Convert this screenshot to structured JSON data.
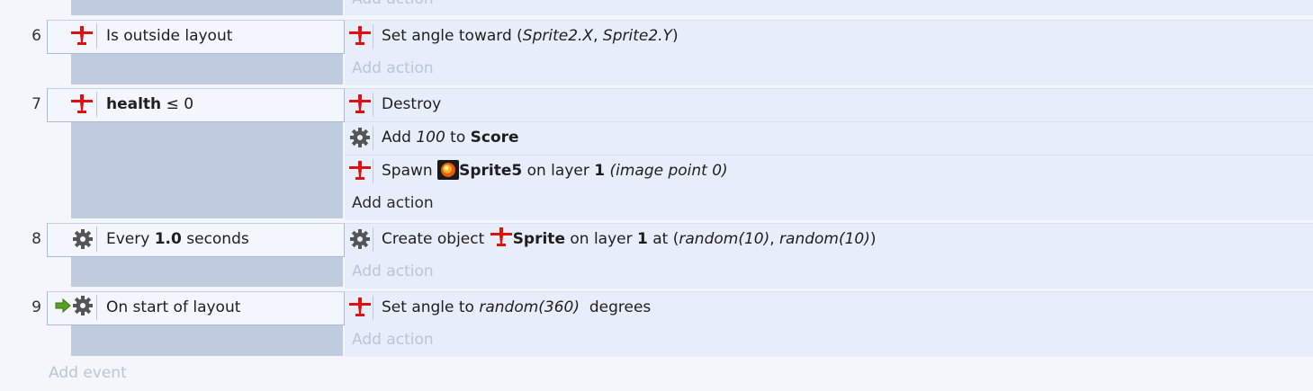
{
  "top_partial": {
    "add_action": "Add action"
  },
  "events": [
    {
      "number": "6",
      "condition": {
        "icon": "plane-icon",
        "text": "Is outside layout"
      },
      "actions": [
        {
          "icon": "plane-icon",
          "prefix": "Set angle toward (",
          "arg1": "Sprite2.X",
          "sep": ", ",
          "arg2": "Sprite2.Y",
          "suffix": ")"
        }
      ],
      "add_action": "Add action"
    },
    {
      "number": "7",
      "condition": {
        "icon": "plane-icon",
        "bold": "health",
        "rest": " ≤ 0"
      },
      "actions": [
        {
          "icon": "plane-icon",
          "text": "Destroy"
        },
        {
          "icon": "gear-icon",
          "prefix": "Add ",
          "value": "100",
          "mid": " to ",
          "target": "Score"
        },
        {
          "icon": "plane-icon",
          "prefix": "Spawn ",
          "object_icon": "explosion-icon",
          "object": "Sprite5",
          "mid": " on layer ",
          "layer": "1",
          "extra": "(image point 0)"
        }
      ],
      "add_action": "Add action"
    },
    {
      "number": "8",
      "condition": {
        "icon": "gear-icon",
        "prefix": "Every ",
        "bold": "1.0",
        "rest": " seconds"
      },
      "actions": [
        {
          "icon": "gear-icon",
          "prefix": "Create object ",
          "object_icon": "plane-icon",
          "object": "Sprite",
          "mid": " on layer ",
          "layer": "1",
          "at": " at (",
          "arg1": "random(10)",
          "sep": ", ",
          "arg2": "random(10)",
          "suffix": ")"
        }
      ],
      "add_action": "Add action"
    },
    {
      "number": "9",
      "condition": {
        "icon": "gear-icon",
        "trigger_icon": "trigger-arrow-icon",
        "text": "On start of layout"
      },
      "actions": [
        {
          "icon": "plane-icon",
          "prefix": "Set angle to ",
          "value": "random(360)",
          "suffix": "  degrees"
        }
      ],
      "add_action": "Add action"
    }
  ],
  "add_event": "Add event",
  "colors": {
    "plane": "#e01010",
    "gear": "#555555",
    "arrow": "#5aa020"
  }
}
